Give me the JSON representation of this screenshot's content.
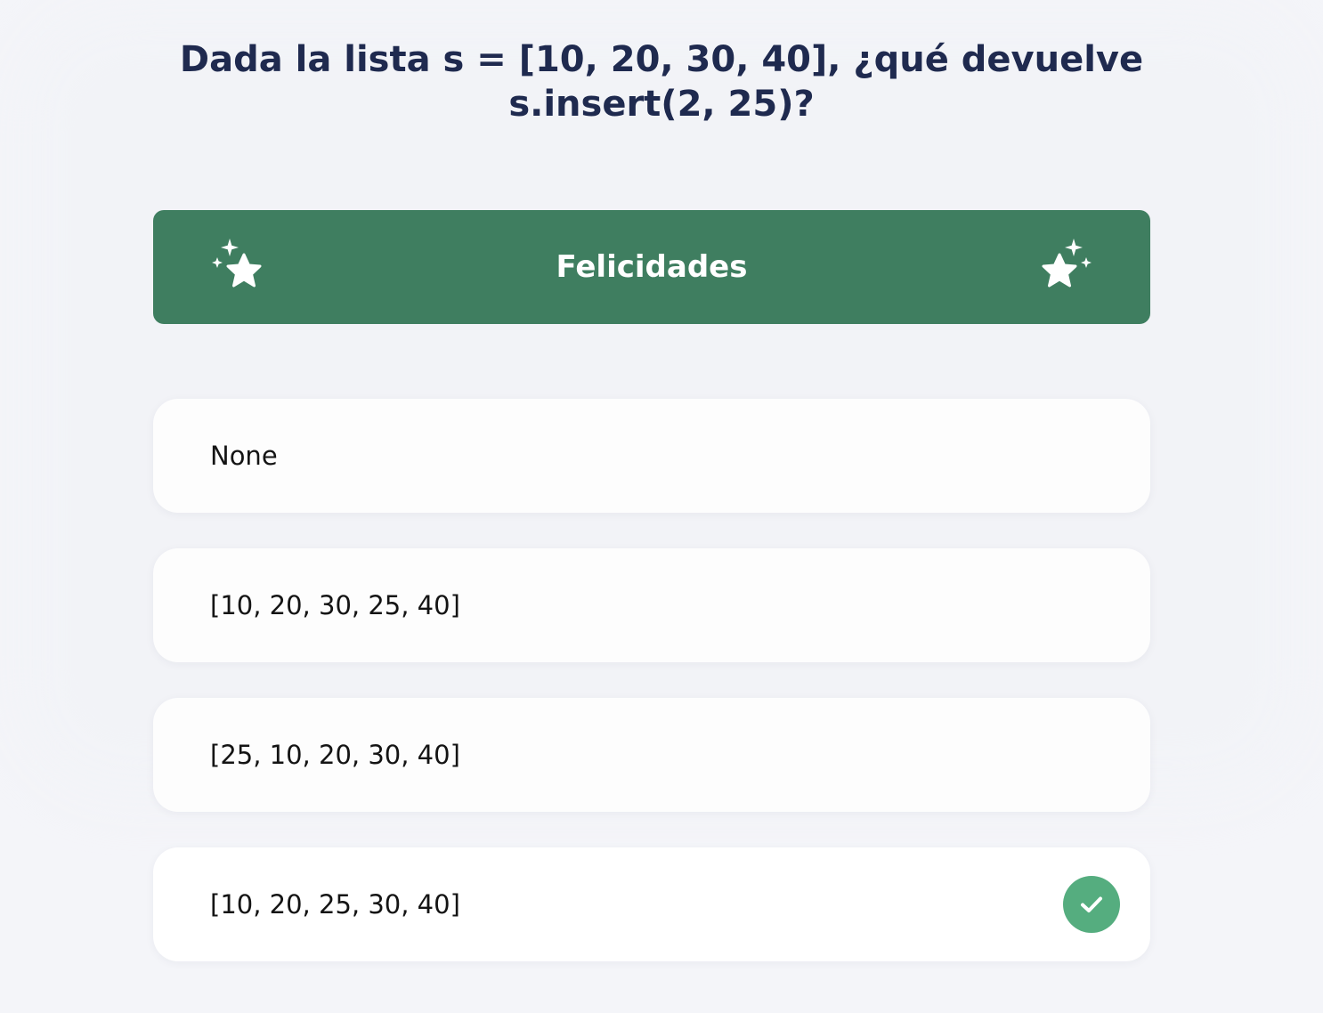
{
  "question": {
    "text": "Dada la lista s = [10, 20, 30, 40], ¿qué devuelve s.insert(2, 25)?"
  },
  "banner": {
    "title": "Felicidades",
    "left_icon": "stars-icon",
    "right_icon": "stars-icon",
    "color": "#3f7e60"
  },
  "options": [
    {
      "label": "None",
      "selected": false
    },
    {
      "label": "[10, 20, 30, 25, 40]",
      "selected": false
    },
    {
      "label": "[25, 10, 20, 30, 40]",
      "selected": false
    },
    {
      "label": "[10, 20, 25, 30, 40]",
      "selected": true,
      "status_icon": "check-icon"
    }
  ],
  "colors": {
    "title": "#1f2a4f",
    "correct_badge": "#55ad7f",
    "background": "#f4f5f9"
  }
}
